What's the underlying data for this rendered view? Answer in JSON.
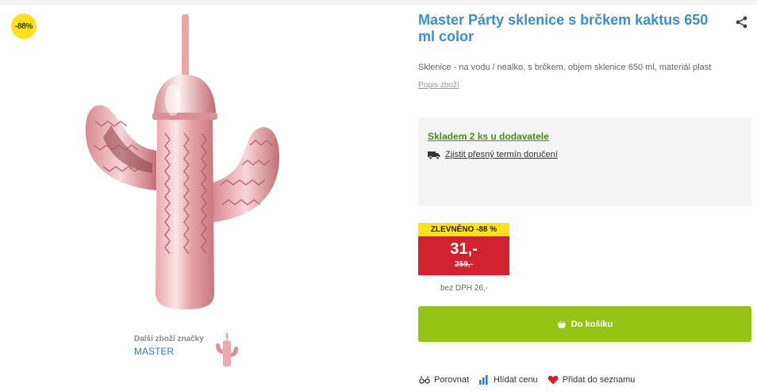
{
  "gallery": {
    "discount_badge": "-88%",
    "brand_caption": "Další zboží značky",
    "brand_name": "MASTER"
  },
  "product": {
    "title": "Master Párty sklenice s brčkem kaktus 650 ml color",
    "short_description": "Sklenice - na vodu / nealko, s brčkem, objem sklenice 650 ml, materiál plast",
    "description_link": "Popis zboží"
  },
  "availability": {
    "stock_text": "Skladem 2 ks u dodavatele",
    "delivery_link": "Zjistit přesný termín doručení"
  },
  "price": {
    "discount_flag": "ZLEVNĚNO -88 %",
    "current": "31,-",
    "original": "259,-",
    "without_vat": "bez DPH 26,-"
  },
  "cart": {
    "button_label": "Do košíku"
  },
  "actions": {
    "compare": "Porovnat",
    "watch_price": "Hlídat cenu",
    "add_to_list": "Přidat do seznamu"
  },
  "colors": {
    "title_blue": "#3b8fd0",
    "stock_green": "#4a8a1c",
    "price_red": "#d0232f",
    "flag_yellow": "#ffe11a",
    "cart_green": "#96c414"
  },
  "icons": [
    "share-icon",
    "truck-icon",
    "basket-icon",
    "compare-icon",
    "price-watch-icon",
    "heart-icon"
  ]
}
